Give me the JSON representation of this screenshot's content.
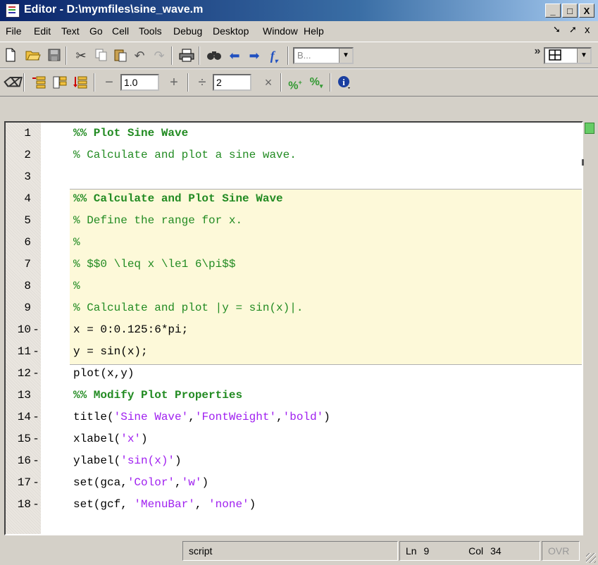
{
  "window": {
    "title": "Editor - D:\\mymfiles\\sine_wave.m",
    "minimize": "_",
    "maximize": "□",
    "close": "X"
  },
  "menu": {
    "items": [
      "File",
      "Edit",
      "Text",
      "Go",
      "Cell",
      "Tools",
      "Debug",
      "Desktop",
      "Window",
      "Help"
    ],
    "undock": "➘",
    "dock": "➚",
    "close": "x"
  },
  "toolbar1": {
    "icons": [
      "new-file-icon",
      "open-icon",
      "save-icon",
      "cut-icon",
      "copy-icon",
      "paste-icon",
      "undo-icon",
      "redo-icon",
      "print-icon",
      "find-icon",
      "back-icon",
      "forward-icon",
      "function-icon"
    ],
    "stack_combo": "B...",
    "overflow": "»",
    "layout_icon": "grid-layout-icon"
  },
  "toolbar2": {
    "icons": [
      "eraser-icon",
      "insert-cell-above-icon",
      "insert-cell-break-icon",
      "insert-cell-below-icon"
    ],
    "minus": "−",
    "value1": "1.0",
    "plus": "+",
    "divide": "÷",
    "value2": "2",
    "times": "×",
    "comment_icons": [
      "add-comment-icon",
      "remove-comment-icon"
    ],
    "info_icon": "info-icon"
  },
  "code": {
    "lines": [
      {
        "num": "1",
        "bp": "",
        "parts": [
          [
            "cell",
            "%% Plot Sine Wave"
          ]
        ]
      },
      {
        "num": "2",
        "bp": "",
        "parts": [
          [
            "cm",
            "% Calculate and plot a sine wave."
          ]
        ]
      },
      {
        "num": "3",
        "bp": "",
        "parts": []
      },
      {
        "num": "4",
        "bp": "",
        "parts": [
          [
            "cell",
            "%% Calculate and Plot Sine Wave"
          ]
        ]
      },
      {
        "num": "5",
        "bp": "",
        "parts": [
          [
            "cm",
            "% Define the range for x."
          ]
        ]
      },
      {
        "num": "6",
        "bp": "",
        "parts": [
          [
            "cm",
            "%"
          ]
        ]
      },
      {
        "num": "7",
        "bp": "",
        "parts": [
          [
            "cm",
            "% $$0 \\leq x \\le1 6\\pi$$"
          ]
        ]
      },
      {
        "num": "8",
        "bp": "",
        "parts": [
          [
            "cm",
            "%"
          ]
        ]
      },
      {
        "num": "9",
        "bp": "",
        "parts": [
          [
            "cm",
            "% Calculate and plot |y = sin(x)|."
          ]
        ]
      },
      {
        "num": "10",
        "bp": "-",
        "parts": [
          [
            "kw",
            "x = 0:0.125:6*pi;"
          ]
        ]
      },
      {
        "num": "11",
        "bp": "-",
        "parts": [
          [
            "kw",
            "y = sin(x);"
          ]
        ]
      },
      {
        "num": "12",
        "bp": "-",
        "parts": [
          [
            "kw",
            "plot(x,y)"
          ]
        ]
      },
      {
        "num": "13",
        "bp": "",
        "parts": [
          [
            "cell",
            "%% Modify Plot Properties"
          ]
        ]
      },
      {
        "num": "14",
        "bp": "-",
        "parts": [
          [
            "kw",
            "title("
          ],
          [
            "str",
            "'Sine Wave'"
          ],
          [
            "kw",
            ","
          ],
          [
            "str",
            "'FontWeight'"
          ],
          [
            "kw",
            ","
          ],
          [
            "str",
            "'bold'"
          ],
          [
            "kw",
            ")"
          ]
        ]
      },
      {
        "num": "15",
        "bp": "-",
        "parts": [
          [
            "kw",
            "xlabel("
          ],
          [
            "str",
            "'x'"
          ],
          [
            "kw",
            ")"
          ]
        ]
      },
      {
        "num": "16",
        "bp": "-",
        "parts": [
          [
            "kw",
            "ylabel("
          ],
          [
            "str",
            "'sin(x)'"
          ],
          [
            "kw",
            ")"
          ]
        ]
      },
      {
        "num": "17",
        "bp": "-",
        "parts": [
          [
            "kw",
            "set(gca,"
          ],
          [
            "str",
            "'Color'"
          ],
          [
            "kw",
            ","
          ],
          [
            "str",
            "'w'"
          ],
          [
            "kw",
            ")"
          ]
        ]
      },
      {
        "num": "18",
        "bp": "-",
        "parts": [
          [
            "kw",
            "set(gcf, "
          ],
          [
            "str",
            "'MenuBar'"
          ],
          [
            "kw",
            ", "
          ],
          [
            "str",
            "'none'"
          ],
          [
            "kw",
            ")"
          ]
        ]
      }
    ]
  },
  "status": {
    "mode": "script",
    "ln_label": "Ln",
    "ln_value": "9",
    "col_label": "Col",
    "col_value": "34",
    "ovr": "OVR"
  },
  "colors": {
    "comment": "#228b22",
    "string": "#a020f0",
    "cell_highlight": "#fdf9d9"
  }
}
